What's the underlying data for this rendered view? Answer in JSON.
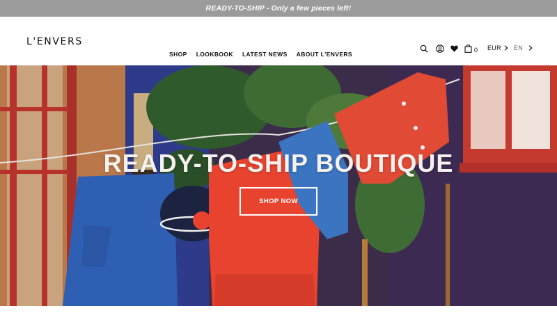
{
  "announcement": {
    "text": "READY-TO-SHIP - Only a few pieces left!"
  },
  "header": {
    "logo": "L'ENVERS",
    "nav": [
      {
        "label": "SHOP"
      },
      {
        "label": "LOOKBOOK"
      },
      {
        "label": "LATEST NEWS"
      },
      {
        "label": "ABOUT L'ENVERS"
      }
    ],
    "icons": [
      "search-icon",
      "account-icon",
      "heart-icon",
      "bag-icon"
    ],
    "cart_count": "0",
    "currency": "EUR",
    "language": "EN"
  },
  "hero": {
    "title": "READY-TO-SHIP BOUTIQUE",
    "button_label": "SHOP NOW"
  },
  "colors": {
    "announcement_bg": "#9b9b9b",
    "text_dark": "#111111",
    "hero_text": "#f4f1ee",
    "knit_red": "#e8432f",
    "knit_blue": "#2f5fb3"
  }
}
